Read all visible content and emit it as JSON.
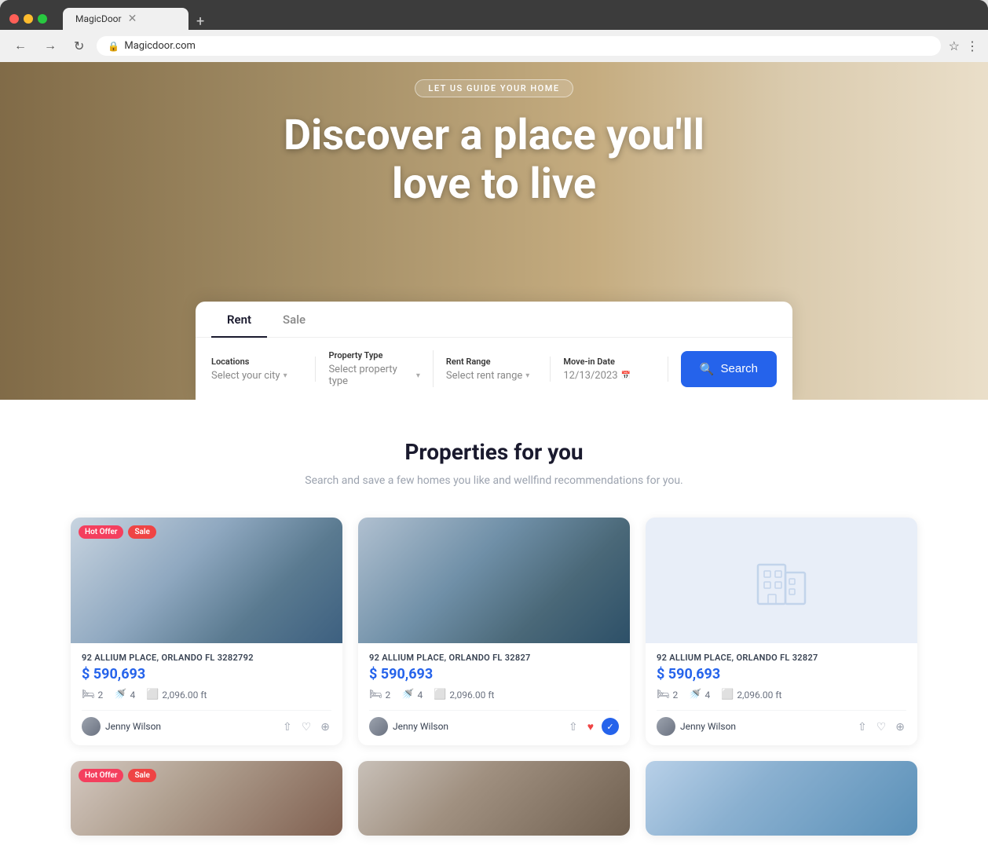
{
  "browser": {
    "tab_title": "MagicDoor",
    "url": "Magicdoor.com",
    "new_tab_icon": "+",
    "back_icon": "←",
    "forward_icon": "→",
    "refresh_icon": "↻"
  },
  "hero": {
    "badge": "LET US GUIDE YOUR HOME",
    "title_line1": "Discover a place you'll",
    "title_line2": "love to live"
  },
  "search": {
    "tab_rent": "Rent",
    "tab_sale": "Sale",
    "active_tab": "Rent",
    "fields": {
      "location_label": "Locations",
      "location_placeholder": "Select your city",
      "property_label": "Property Type",
      "property_placeholder": "Select property type",
      "rent_label": "Rent Range",
      "rent_placeholder": "Select rent range",
      "movein_label": "Move-in Date",
      "movein_value": "12/13/2023"
    },
    "search_button": "Search"
  },
  "properties_section": {
    "title": "Properties for you",
    "subtitle": "Search and save a few homes you like and wellfind\nrecommendations for you.",
    "cards": [
      {
        "id": 1,
        "badge_hot": "Hot Offer",
        "badge_sale": "Sale",
        "address": "92 ALLIUM PLACE, ORLANDO FL 3282792",
        "price": "$ 590,693",
        "beds": "2",
        "baths": "4",
        "sqft": "2,096.00 ft",
        "agent": "Jenny Wilson",
        "image_type": "modern-house",
        "has_badges": true,
        "heart_filled": false,
        "check_filled": false
      },
      {
        "id": 2,
        "badge_hot": "",
        "badge_sale": "",
        "address": "92 ALLIUM PLACE, ORLANDO FL 32827",
        "price": "$ 590,693",
        "beds": "2",
        "baths": "4",
        "sqft": "2,096.00 ft",
        "agent": "Jenny Wilson",
        "image_type": "house-2",
        "has_badges": false,
        "heart_filled": true,
        "check_filled": true
      },
      {
        "id": 3,
        "badge_hot": "",
        "badge_sale": "",
        "address": "92 ALLIUM PLACE, ORLANDO FL 32827",
        "price": "$ 590,693",
        "beds": "2",
        "baths": "4",
        "sqft": "2,096.00 ft",
        "agent": "Jenny Wilson",
        "image_type": "placeholder",
        "has_badges": false,
        "heart_filled": false,
        "check_filled": false
      }
    ],
    "row2_cards": [
      {
        "id": 4,
        "badge_hot": "Hot Offer",
        "badge_sale": "Sale",
        "image_type": "row2-1",
        "has_badges": true
      },
      {
        "id": 5,
        "image_type": "row2-2",
        "has_badges": false
      },
      {
        "id": 6,
        "image_type": "row2-3",
        "has_badges": false
      }
    ]
  },
  "icons": {
    "search": "🔍",
    "bed": "🛏",
    "bath": "🚿",
    "area": "⬜",
    "share": "⇧",
    "heart": "♡",
    "heart_filled": "♥",
    "plus": "+",
    "calendar": "📅",
    "lock": "🔒",
    "chevron_down": "▾",
    "check": "✓"
  },
  "colors": {
    "primary": "#2563eb",
    "accent_red": "#ef4444",
    "text_dark": "#1a1a2e",
    "text_muted": "#9ca3af"
  }
}
